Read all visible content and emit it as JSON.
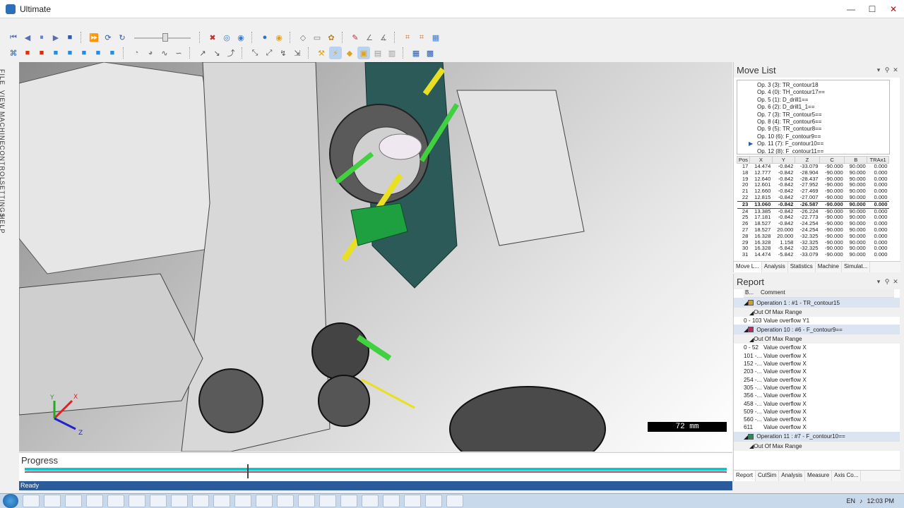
{
  "window": {
    "title": "Ultimate"
  },
  "toolbar": {
    "row1": [
      "skip-start",
      "step-back",
      "pause",
      "step-forward",
      "stop",
      "fast-forward",
      "refresh",
      "reload",
      "speed-slider",
      "tool-a",
      "tool-b",
      "tool-c",
      "globe",
      "target",
      "cube",
      "grid",
      "wrench",
      "measure",
      "measure2",
      "xyz1",
      "xyz2",
      "xyz3"
    ],
    "row2": [
      "view-iso",
      "cube-red",
      "cube-front",
      "cube-top",
      "cube-side",
      "cube-right",
      "cube-back",
      "pan",
      "orbit",
      "line",
      "curve",
      "wire",
      "shade",
      "part",
      "tool",
      "clip",
      "zoom",
      "fit"
    ]
  },
  "sidetabs": [
    "FILE",
    "VIEW",
    "MACHINE",
    "CONTROL",
    "SETTINGS",
    "HELP"
  ],
  "viewport": {
    "scale_label": "72 mm",
    "axes": [
      "X",
      "Y",
      "Z"
    ]
  },
  "progress": {
    "title": "Progress"
  },
  "status": {
    "text": "Ready"
  },
  "movelist": {
    "title": "Move List",
    "ops": [
      {
        "label": "Op. 3 (3): TR_contour18",
        "active": false
      },
      {
        "label": "Op. 4 (0): TH_contour17==",
        "active": false
      },
      {
        "label": "Op. 5 (1): D_drill1==",
        "active": false
      },
      {
        "label": "Op. 6 (2): D_drill1_1==",
        "active": false
      },
      {
        "label": "Op. 7 (3): TR_contour5==",
        "active": false
      },
      {
        "label": "Op. 8 (4): TR_contour6==",
        "active": false
      },
      {
        "label": "Op. 9 (5): TR_contour8==",
        "active": false
      },
      {
        "label": "Op. 10 (6): F_contour9==",
        "active": false
      },
      {
        "label": "Op. 11 (7): F_contour10==",
        "active": true
      },
      {
        "label": "Op. 12 (8): F_contour11==",
        "active": false
      }
    ],
    "columns": [
      "Pos",
      "X",
      "Y",
      "Z",
      "C",
      "B",
      "TRAx1"
    ],
    "rows": [
      [
        "17",
        "14.474",
        "-0.842",
        "-33.079",
        "-90.000",
        "90.000",
        "0.000"
      ],
      [
        "18",
        "12.777",
        "-0.842",
        "-28.904",
        "-90.000",
        "90.000",
        "0.000"
      ],
      [
        "19",
        "12.640",
        "-0.842",
        "-28.437",
        "-90.000",
        "90.000",
        "0.000"
      ],
      [
        "20",
        "12.601",
        "-0.842",
        "-27.952",
        "-90.000",
        "90.000",
        "0.000"
      ],
      [
        "21",
        "12.660",
        "-0.842",
        "-27.469",
        "-90.000",
        "90.000",
        "0.000"
      ],
      [
        "22",
        "12.815",
        "-0.842",
        "-27.007",
        "-90.000",
        "90.000",
        "0.000"
      ],
      [
        "23",
        "13.060",
        "-0.842",
        "-26.587",
        "-90.000",
        "90.000",
        "0.000"
      ],
      [
        "24",
        "13.385",
        "-0.842",
        "-26.224",
        "-90.000",
        "90.000",
        "0.000"
      ],
      [
        "25",
        "17.181",
        "-0.842",
        "-22.773",
        "-90.000",
        "90.000",
        "0.000"
      ],
      [
        "26",
        "18.527",
        "-0.842",
        "-24.254",
        "-90.000",
        "90.000",
        "0.000"
      ],
      [
        "27",
        "18.527",
        "20.000",
        "-24.254",
        "-90.000",
        "90.000",
        "0.000"
      ],
      [
        "28",
        "16.328",
        "20.000",
        "-32.325",
        "-90.000",
        "90.000",
        "0.000"
      ],
      [
        "29",
        "16.328",
        "1.158",
        "-32.325",
        "-90.000",
        "90.000",
        "0.000"
      ],
      [
        "30",
        "16.328",
        "-5.842",
        "-32.325",
        "-90.000",
        "90.000",
        "0.000"
      ],
      [
        "31",
        "14.474",
        "-5.842",
        "-33.079",
        "-90.000",
        "90.000",
        "0.000"
      ]
    ],
    "current_row": 6,
    "tabs": [
      "Move L...",
      "Analysis",
      "Statistics",
      "Machine",
      "Simulat..."
    ]
  },
  "report": {
    "title": "Report",
    "columns": [
      "B...",
      "Comment"
    ],
    "sections": [
      {
        "op": "Operation 1 : #1 - TR_contour15",
        "color": "#c8a040",
        "group": "Out Of Max Range",
        "items": [
          [
            "0 - 103",
            "Value overflow Y1"
          ]
        ]
      },
      {
        "op": "Operation 10 : #6 - F_contour9==",
        "color": "#b03060",
        "group": "Out Of Max Range",
        "items": [
          [
            "0 - 52",
            "Value overflow X"
          ],
          [
            "101 -...",
            "Value overflow X"
          ],
          [
            "152 -...",
            "Value overflow X"
          ],
          [
            "203 -...",
            "Value overflow X"
          ],
          [
            "254 -...",
            "Value overflow X"
          ],
          [
            "305 -...",
            "Value overflow X"
          ],
          [
            "356 -...",
            "Value overflow X"
          ],
          [
            "458 -...",
            "Value overflow X"
          ],
          [
            "509 -...",
            "Value overflow X"
          ],
          [
            "560 -...",
            "Value overflow X"
          ],
          [
            "611",
            "Value overflow X"
          ]
        ]
      },
      {
        "op": "Operation 11 : #7 - F_contour10==",
        "color": "#2a8a5a",
        "group": "Out Of Max Range",
        "items": []
      }
    ],
    "tabs": [
      "Report",
      "CutSim",
      "Analysis",
      "Measure",
      "Axis Co..."
    ]
  },
  "taskbar": {
    "apps": [
      "chrome",
      "os",
      "folder",
      "media",
      "word",
      "firefox",
      "skype",
      "x",
      "pdf",
      "app1",
      "app2",
      "app3",
      "app4",
      "app5",
      "app6",
      "app7",
      "app8",
      "app9",
      "app10",
      "app11",
      "app12"
    ],
    "clock": "12:03 PM",
    "lang": "EN"
  }
}
